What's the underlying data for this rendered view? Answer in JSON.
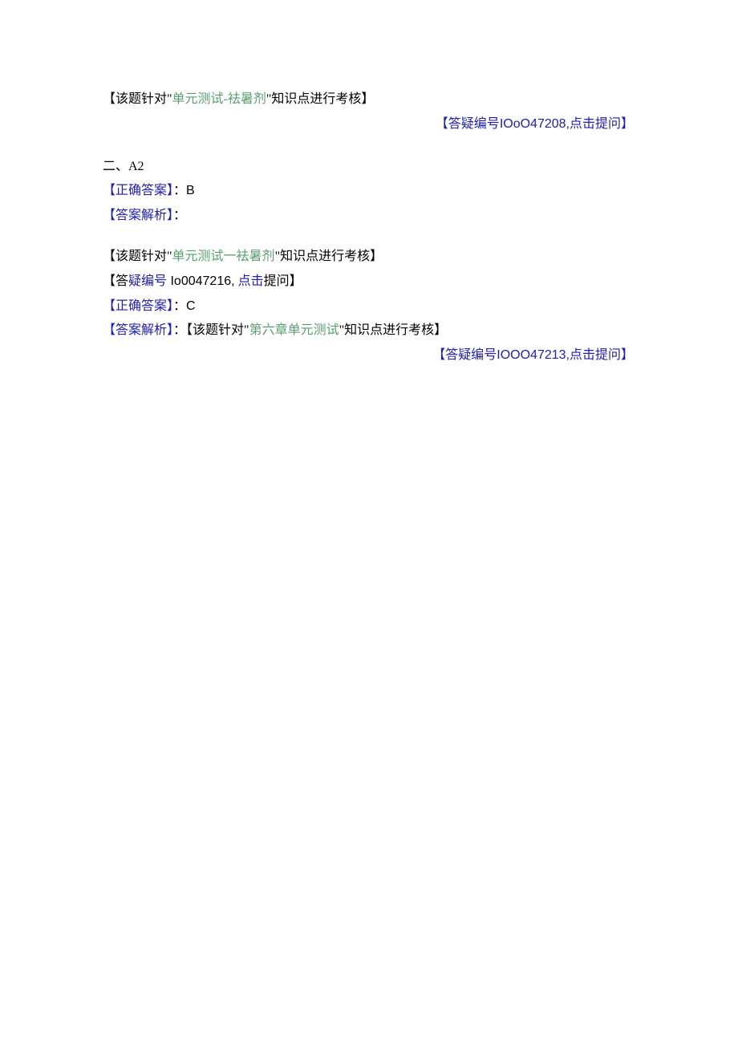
{
  "block1": {
    "line1": {
      "prefix": "【该题针对\"",
      "green": "单元测试-袪暑剂",
      "suffix": "\"知识点进行考核】"
    },
    "line2": {
      "prefix": "【答疑编号",
      "arial": "IOoO47208,",
      "suffix": "点击提问】"
    }
  },
  "block2": {
    "heading": "二、A2",
    "line1": {
      "label": "【正确答案】",
      "colon": "：",
      "value": "B"
    },
    "line2": {
      "label": "【答案解析】",
      "colon": "："
    }
  },
  "block3": {
    "line1": {
      "prefix": "【该题针对\"",
      "green": "单元测试一袪暑剂",
      "suffix": "\"知识点进行考核】"
    },
    "line2": {
      "prefix": "【答",
      "blue1": "疑编号",
      "arial": "Io0047216,",
      "blue2": "点击",
      "suffix": "提问】"
    },
    "line3": {
      "label": "【正确答案】",
      "colon": "：",
      "value": "C"
    },
    "line4": {
      "label": "【答案解析】",
      "colon": "：",
      "prefix": "【该题针对\"",
      "green": "第六章单元测试",
      "suffix": "\"知识点进行考核】"
    },
    "line5": {
      "prefix": "【答疑编号",
      "arial": "IOOO47213,",
      "suffix": "点击提问】"
    }
  }
}
